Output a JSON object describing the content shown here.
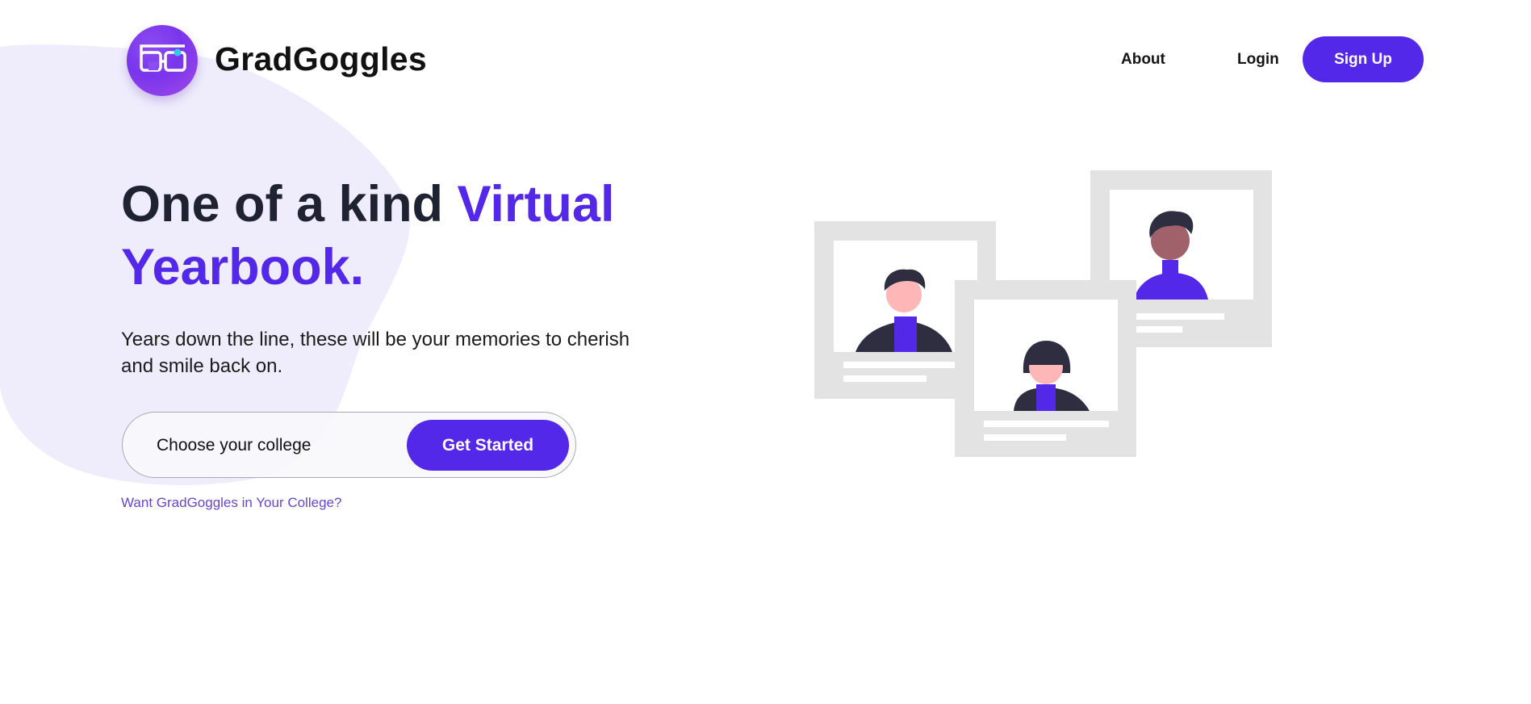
{
  "header": {
    "brand": "GradGoggles",
    "nav": {
      "about": "About",
      "login": "Login",
      "signup": "Sign Up"
    }
  },
  "hero": {
    "headline_start": "One of a kind ",
    "headline_accent": "Virtual Yearbook.",
    "subtext": "Years down the line, these will be your memories to cherish and smile back on.",
    "college_input_placeholder": "Choose your college",
    "cta": "Get Started",
    "college_link": "Want GradGoggles in Your College?"
  },
  "colors": {
    "accent": "#5428e8",
    "text_dark": "#1f2230",
    "blob": "#efedfc",
    "card_gray": "#e3e3e3",
    "link": "#6747c7"
  },
  "icons": [
    "goggles-logo-icon",
    "yearbook-illustration"
  ]
}
